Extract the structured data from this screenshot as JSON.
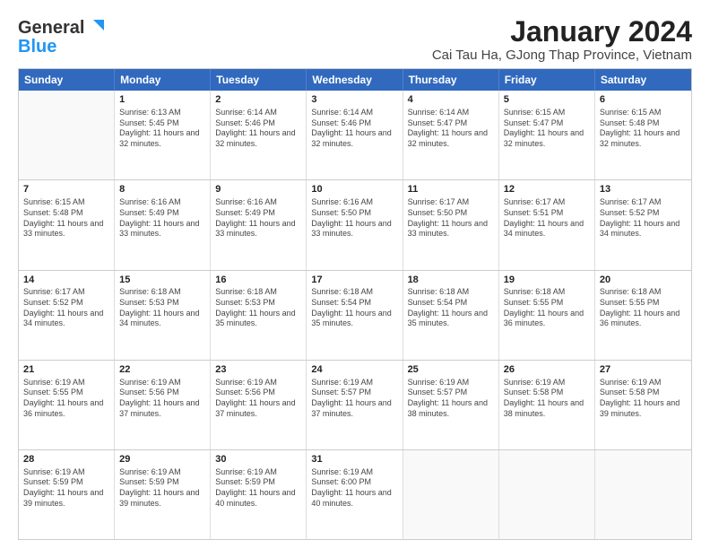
{
  "logo": {
    "line1": "General",
    "line2": "Blue"
  },
  "title": "January 2024",
  "subtitle": "Cai Tau Ha, GJong Thap Province, Vietnam",
  "headers": [
    "Sunday",
    "Monday",
    "Tuesday",
    "Wednesday",
    "Thursday",
    "Friday",
    "Saturday"
  ],
  "rows": [
    [
      {
        "day": "",
        "sunrise": "",
        "sunset": "",
        "daylight": ""
      },
      {
        "day": "1",
        "sunrise": "Sunrise: 6:13 AM",
        "sunset": "Sunset: 5:45 PM",
        "daylight": "Daylight: 11 hours and 32 minutes."
      },
      {
        "day": "2",
        "sunrise": "Sunrise: 6:14 AM",
        "sunset": "Sunset: 5:46 PM",
        "daylight": "Daylight: 11 hours and 32 minutes."
      },
      {
        "day": "3",
        "sunrise": "Sunrise: 6:14 AM",
        "sunset": "Sunset: 5:46 PM",
        "daylight": "Daylight: 11 hours and 32 minutes."
      },
      {
        "day": "4",
        "sunrise": "Sunrise: 6:14 AM",
        "sunset": "Sunset: 5:47 PM",
        "daylight": "Daylight: 11 hours and 32 minutes."
      },
      {
        "day": "5",
        "sunrise": "Sunrise: 6:15 AM",
        "sunset": "Sunset: 5:47 PM",
        "daylight": "Daylight: 11 hours and 32 minutes."
      },
      {
        "day": "6",
        "sunrise": "Sunrise: 6:15 AM",
        "sunset": "Sunset: 5:48 PM",
        "daylight": "Daylight: 11 hours and 32 minutes."
      }
    ],
    [
      {
        "day": "7",
        "sunrise": "Sunrise: 6:15 AM",
        "sunset": "Sunset: 5:48 PM",
        "daylight": "Daylight: 11 hours and 33 minutes."
      },
      {
        "day": "8",
        "sunrise": "Sunrise: 6:16 AM",
        "sunset": "Sunset: 5:49 PM",
        "daylight": "Daylight: 11 hours and 33 minutes."
      },
      {
        "day": "9",
        "sunrise": "Sunrise: 6:16 AM",
        "sunset": "Sunset: 5:49 PM",
        "daylight": "Daylight: 11 hours and 33 minutes."
      },
      {
        "day": "10",
        "sunrise": "Sunrise: 6:16 AM",
        "sunset": "Sunset: 5:50 PM",
        "daylight": "Daylight: 11 hours and 33 minutes."
      },
      {
        "day": "11",
        "sunrise": "Sunrise: 6:17 AM",
        "sunset": "Sunset: 5:50 PM",
        "daylight": "Daylight: 11 hours and 33 minutes."
      },
      {
        "day": "12",
        "sunrise": "Sunrise: 6:17 AM",
        "sunset": "Sunset: 5:51 PM",
        "daylight": "Daylight: 11 hours and 34 minutes."
      },
      {
        "day": "13",
        "sunrise": "Sunrise: 6:17 AM",
        "sunset": "Sunset: 5:52 PM",
        "daylight": "Daylight: 11 hours and 34 minutes."
      }
    ],
    [
      {
        "day": "14",
        "sunrise": "Sunrise: 6:17 AM",
        "sunset": "Sunset: 5:52 PM",
        "daylight": "Daylight: 11 hours and 34 minutes."
      },
      {
        "day": "15",
        "sunrise": "Sunrise: 6:18 AM",
        "sunset": "Sunset: 5:53 PM",
        "daylight": "Daylight: 11 hours and 34 minutes."
      },
      {
        "day": "16",
        "sunrise": "Sunrise: 6:18 AM",
        "sunset": "Sunset: 5:53 PM",
        "daylight": "Daylight: 11 hours and 35 minutes."
      },
      {
        "day": "17",
        "sunrise": "Sunrise: 6:18 AM",
        "sunset": "Sunset: 5:54 PM",
        "daylight": "Daylight: 11 hours and 35 minutes."
      },
      {
        "day": "18",
        "sunrise": "Sunrise: 6:18 AM",
        "sunset": "Sunset: 5:54 PM",
        "daylight": "Daylight: 11 hours and 35 minutes."
      },
      {
        "day": "19",
        "sunrise": "Sunrise: 6:18 AM",
        "sunset": "Sunset: 5:55 PM",
        "daylight": "Daylight: 11 hours and 36 minutes."
      },
      {
        "day": "20",
        "sunrise": "Sunrise: 6:18 AM",
        "sunset": "Sunset: 5:55 PM",
        "daylight": "Daylight: 11 hours and 36 minutes."
      }
    ],
    [
      {
        "day": "21",
        "sunrise": "Sunrise: 6:19 AM",
        "sunset": "Sunset: 5:55 PM",
        "daylight": "Daylight: 11 hours and 36 minutes."
      },
      {
        "day": "22",
        "sunrise": "Sunrise: 6:19 AM",
        "sunset": "Sunset: 5:56 PM",
        "daylight": "Daylight: 11 hours and 37 minutes."
      },
      {
        "day": "23",
        "sunrise": "Sunrise: 6:19 AM",
        "sunset": "Sunset: 5:56 PM",
        "daylight": "Daylight: 11 hours and 37 minutes."
      },
      {
        "day": "24",
        "sunrise": "Sunrise: 6:19 AM",
        "sunset": "Sunset: 5:57 PM",
        "daylight": "Daylight: 11 hours and 37 minutes."
      },
      {
        "day": "25",
        "sunrise": "Sunrise: 6:19 AM",
        "sunset": "Sunset: 5:57 PM",
        "daylight": "Daylight: 11 hours and 38 minutes."
      },
      {
        "day": "26",
        "sunrise": "Sunrise: 6:19 AM",
        "sunset": "Sunset: 5:58 PM",
        "daylight": "Daylight: 11 hours and 38 minutes."
      },
      {
        "day": "27",
        "sunrise": "Sunrise: 6:19 AM",
        "sunset": "Sunset: 5:58 PM",
        "daylight": "Daylight: 11 hours and 39 minutes."
      }
    ],
    [
      {
        "day": "28",
        "sunrise": "Sunrise: 6:19 AM",
        "sunset": "Sunset: 5:59 PM",
        "daylight": "Daylight: 11 hours and 39 minutes."
      },
      {
        "day": "29",
        "sunrise": "Sunrise: 6:19 AM",
        "sunset": "Sunset: 5:59 PM",
        "daylight": "Daylight: 11 hours and 39 minutes."
      },
      {
        "day": "30",
        "sunrise": "Sunrise: 6:19 AM",
        "sunset": "Sunset: 5:59 PM",
        "daylight": "Daylight: 11 hours and 40 minutes."
      },
      {
        "day": "31",
        "sunrise": "Sunrise: 6:19 AM",
        "sunset": "Sunset: 6:00 PM",
        "daylight": "Daylight: 11 hours and 40 minutes."
      },
      {
        "day": "",
        "sunrise": "",
        "sunset": "",
        "daylight": ""
      },
      {
        "day": "",
        "sunrise": "",
        "sunset": "",
        "daylight": ""
      },
      {
        "day": "",
        "sunrise": "",
        "sunset": "",
        "daylight": ""
      }
    ]
  ]
}
